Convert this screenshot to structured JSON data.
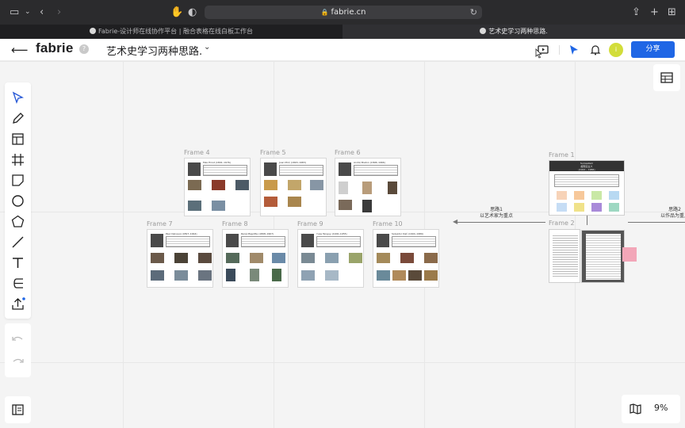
{
  "browser": {
    "url": "fabrie.cn",
    "tabs": [
      {
        "label": "Fabrie-设计师在线协作平台 | 融合表格在线白板工作台",
        "active": false
      },
      {
        "label": "艺术史学习两种思路.",
        "active": true
      }
    ]
  },
  "header": {
    "logo": "fabrie",
    "help": "?",
    "file_name": "艺术史学习两种思路.",
    "avatar_initial": "i",
    "share_label": "分享",
    "accent_color": "#1f66e5"
  },
  "frames": [
    {
      "label": "Frame 4",
      "artist": "Max Ernst (1891–1976)"
    },
    {
      "label": "Frame 5",
      "artist": "Joan Miró (1893–1983)"
    },
    {
      "label": "Frame 6",
      "artist": "André Breton (1896–1966)"
    },
    {
      "label": "Frame 7",
      "artist": "Paul Delvaux (1897–1994)"
    },
    {
      "label": "Frame 8",
      "artist": "René Magritte (1898–1967)"
    },
    {
      "label": "Frame 9",
      "artist": "Yves Tanguy (1900–1955)"
    },
    {
      "label": "Frame 10",
      "artist": "Salvador Dalí (1904–1989)"
    },
    {
      "label": "Frame 1",
      "artist": ""
    },
    {
      "label": "Frame 2",
      "artist": ""
    }
  ],
  "frame1": {
    "title": "Surrealism\n超现实主义\n(1924 – 1966)"
  },
  "annotations": {
    "route1_title": "思路1",
    "route1_sub": "以艺术家为重点",
    "route2_title": "思路2",
    "route2_sub": "以作品为重点"
  },
  "zoom": "9%"
}
